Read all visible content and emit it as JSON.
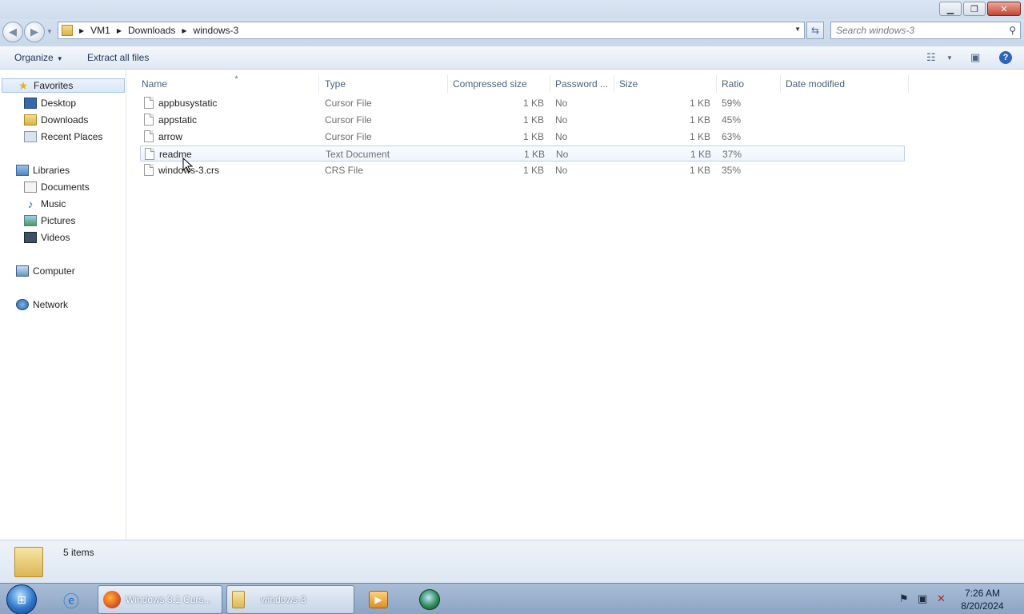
{
  "window": {
    "minimize_glyph": "▁",
    "maximize_glyph": "❐",
    "close_glyph": "✕"
  },
  "address": {
    "crumbs": [
      "VM1",
      "Downloads",
      "windows-3"
    ]
  },
  "search": {
    "placeholder": "Search windows-3"
  },
  "toolbar": {
    "organize_label": "Organize",
    "extract_label": "Extract all files"
  },
  "sidebar": {
    "favorites_label": "Favorites",
    "favorites": [
      "Desktop",
      "Downloads",
      "Recent Places"
    ],
    "libraries_label": "Libraries",
    "libraries": [
      "Documents",
      "Music",
      "Pictures",
      "Videos"
    ],
    "computer_label": "Computer",
    "network_label": "Network"
  },
  "columns": [
    "Name",
    "Type",
    "Compressed size",
    "Password ...",
    "Size",
    "Ratio",
    "Date modified"
  ],
  "files": [
    {
      "name": "appbusystatic",
      "type": "Cursor File",
      "compressed": "1 KB",
      "password": "No",
      "size": "1 KB",
      "ratio": "59%"
    },
    {
      "name": "appstatic",
      "type": "Cursor File",
      "compressed": "1 KB",
      "password": "No",
      "size": "1 KB",
      "ratio": "45%"
    },
    {
      "name": "arrow",
      "type": "Cursor File",
      "compressed": "1 KB",
      "password": "No",
      "size": "1 KB",
      "ratio": "63%"
    },
    {
      "name": "readme",
      "type": "Text Document",
      "compressed": "1 KB",
      "password": "No",
      "size": "1 KB",
      "ratio": "37%"
    },
    {
      "name": "windows-3.crs",
      "type": "CRS File",
      "compressed": "1 KB",
      "password": "No",
      "size": "1 KB",
      "ratio": "35%"
    }
  ],
  "details": {
    "items_count": "5 items"
  },
  "taskbar": {
    "firefox_label": "Windows 3.1 Curs...",
    "explorer_label": "windows-3",
    "time": "7:26 AM",
    "date": "8/20/2024"
  },
  "colors": {
    "accent": "#2c66b8",
    "hover_row": "#eef4fc"
  }
}
